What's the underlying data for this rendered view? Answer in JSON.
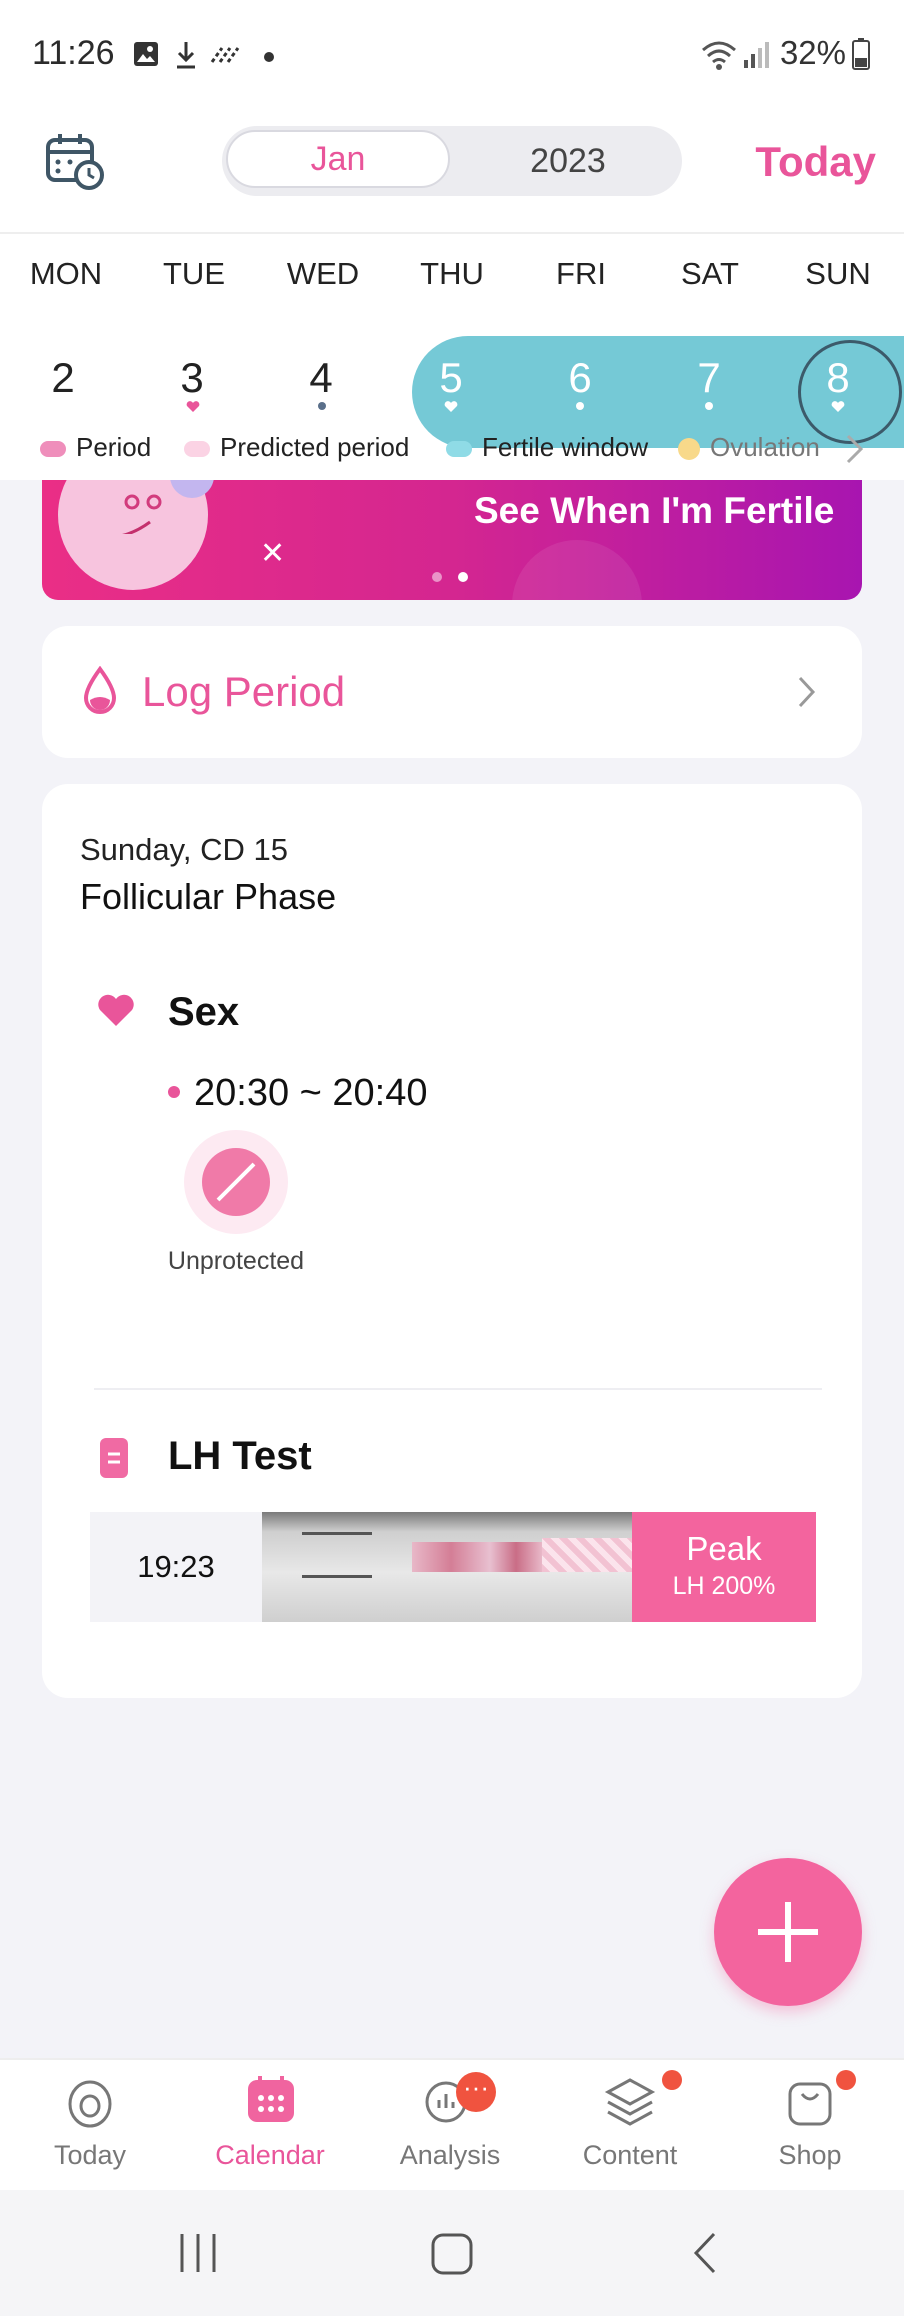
{
  "status_bar": {
    "time": "11:26",
    "battery": "32%"
  },
  "header": {
    "month": "Jan",
    "year": "2023",
    "today_label": "Today"
  },
  "week": {
    "day_names": [
      "MON",
      "TUE",
      "WED",
      "THU",
      "FRI",
      "SAT",
      "SUN"
    ],
    "dates": [
      "2",
      "3",
      "4",
      "5",
      "6",
      "7",
      "8"
    ]
  },
  "legend": {
    "period": "Period",
    "predicted": "Predicted period",
    "fertile": "Fertile window",
    "ovulation": "Ovulation"
  },
  "banner": {
    "text": "See When I'm Fertile"
  },
  "log_period": {
    "label": "Log Period"
  },
  "day_card": {
    "date_line": "Sunday, CD 15",
    "phase": "Follicular Phase",
    "sex": {
      "title": "Sex",
      "time": "20:30 ~ 20:40",
      "protection": "Unprotected"
    },
    "lh_test": {
      "title": "LH Test",
      "time": "19:23",
      "result": "Peak",
      "value": "LH 200%"
    }
  },
  "nav": {
    "items": [
      {
        "label": "Today"
      },
      {
        "label": "Calendar"
      },
      {
        "label": "Analysis"
      },
      {
        "label": "Content"
      },
      {
        "label": "Shop"
      }
    ]
  },
  "colors": {
    "accent": "#e9559a",
    "fertile": "#75c9d6",
    "fab": "#f3649e"
  }
}
